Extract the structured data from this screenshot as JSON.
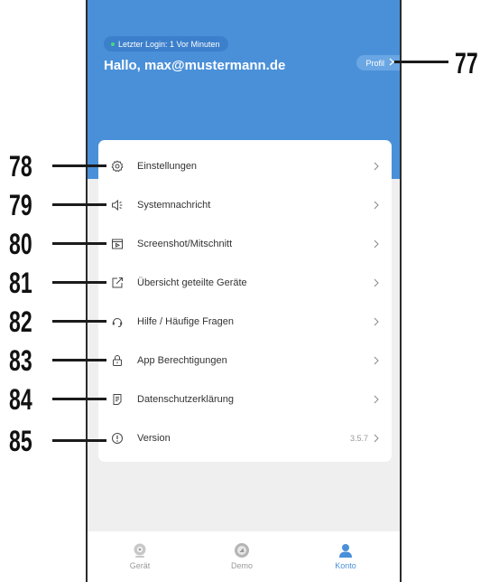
{
  "header": {
    "last_login": "Letzter Login: 1 Vor Minuten",
    "greeting": "Hallo, max@mustermann.de",
    "profile_label": "Profil",
    "background_color": "#4a90d9"
  },
  "menu": [
    {
      "label": "Einstellungen",
      "icon": "gear-icon"
    },
    {
      "label": "Systemnachricht",
      "icon": "speaker-icon"
    },
    {
      "label": "Screenshot/Mitschnitt",
      "icon": "video-icon"
    },
    {
      "label": "Übersicht geteilte Geräte",
      "icon": "share-icon"
    },
    {
      "label": "Hilfe / Häufige Fragen",
      "icon": "headset-icon"
    },
    {
      "label": "App Berechtigungen",
      "icon": "lock-icon"
    },
    {
      "label": "Datenschutzerklärung",
      "icon": "document-icon"
    },
    {
      "label": "Version",
      "icon": "info-icon",
      "value": "3.5.7"
    }
  ],
  "tabbar": {
    "tabs": [
      {
        "label": "Gerät",
        "icon": "device-icon",
        "active": false
      },
      {
        "label": "Demo",
        "icon": "demo-icon",
        "active": false
      },
      {
        "label": "Konto",
        "icon": "account-icon",
        "active": true
      }
    ],
    "accent_color": "#4a90d9"
  },
  "callouts": {
    "profile": "77",
    "rows": [
      "78",
      "79",
      "80",
      "81",
      "82",
      "83",
      "84",
      "85"
    ]
  }
}
